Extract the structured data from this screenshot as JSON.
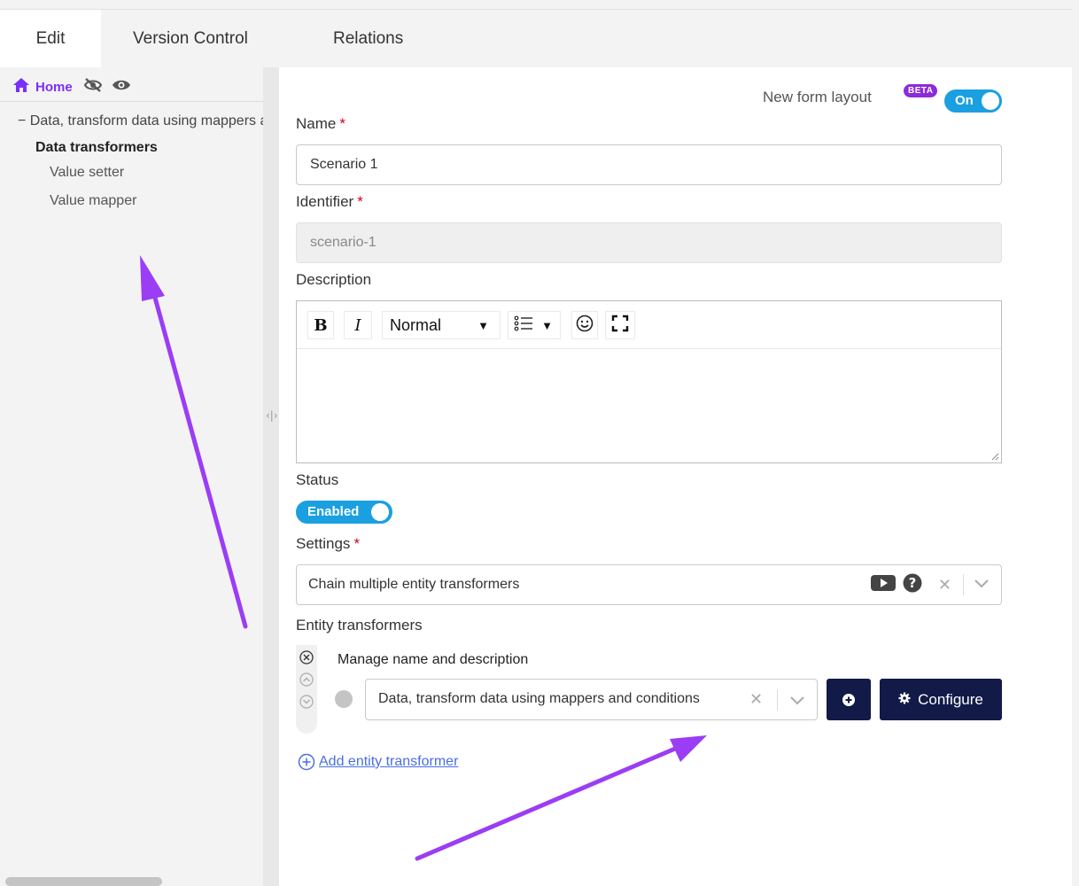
{
  "tabs": [
    {
      "label": "Edit",
      "active": true
    },
    {
      "label": "Version Control",
      "active": false
    },
    {
      "label": "Relations",
      "active": false
    }
  ],
  "sidebar": {
    "home_label": "Home",
    "icons": [
      "home-icon",
      "eye-off-icon",
      "eye-icon"
    ],
    "tree": {
      "root": "− Data, transform data using mappers and conditions",
      "group": "Data transformers",
      "leaves": [
        "Value setter",
        "Value mapper"
      ]
    }
  },
  "form": {
    "new_form_layout_label": "New form layout",
    "beta_badge": "BETA",
    "layout_toggle": "On",
    "name_label": "Name",
    "name_value": "Scenario 1",
    "identifier_label": "Identifier",
    "identifier_value": "scenario-1",
    "description_label": "Description",
    "editor": {
      "bold": "B",
      "italic": "I",
      "style_select": "Normal"
    },
    "status_label": "Status",
    "status_toggle": "Enabled",
    "settings_label": "Settings",
    "settings_value": "Chain multiple entity transformers",
    "entity_transformers_label": "Entity transformers",
    "manage_label": "Manage name and description",
    "transformer_value": "Data, transform data using mappers and conditions",
    "configure_label": "Configure",
    "add_transformer_label": "Add entity transformer",
    "required_marker": "*"
  },
  "colors": {
    "accent_purple": "#7b2ff7",
    "toggle_blue": "#1aa0e0",
    "dark_button": "#121a48",
    "link_blue": "#4a6fe0",
    "annotation_arrow": "#9b3df5"
  }
}
